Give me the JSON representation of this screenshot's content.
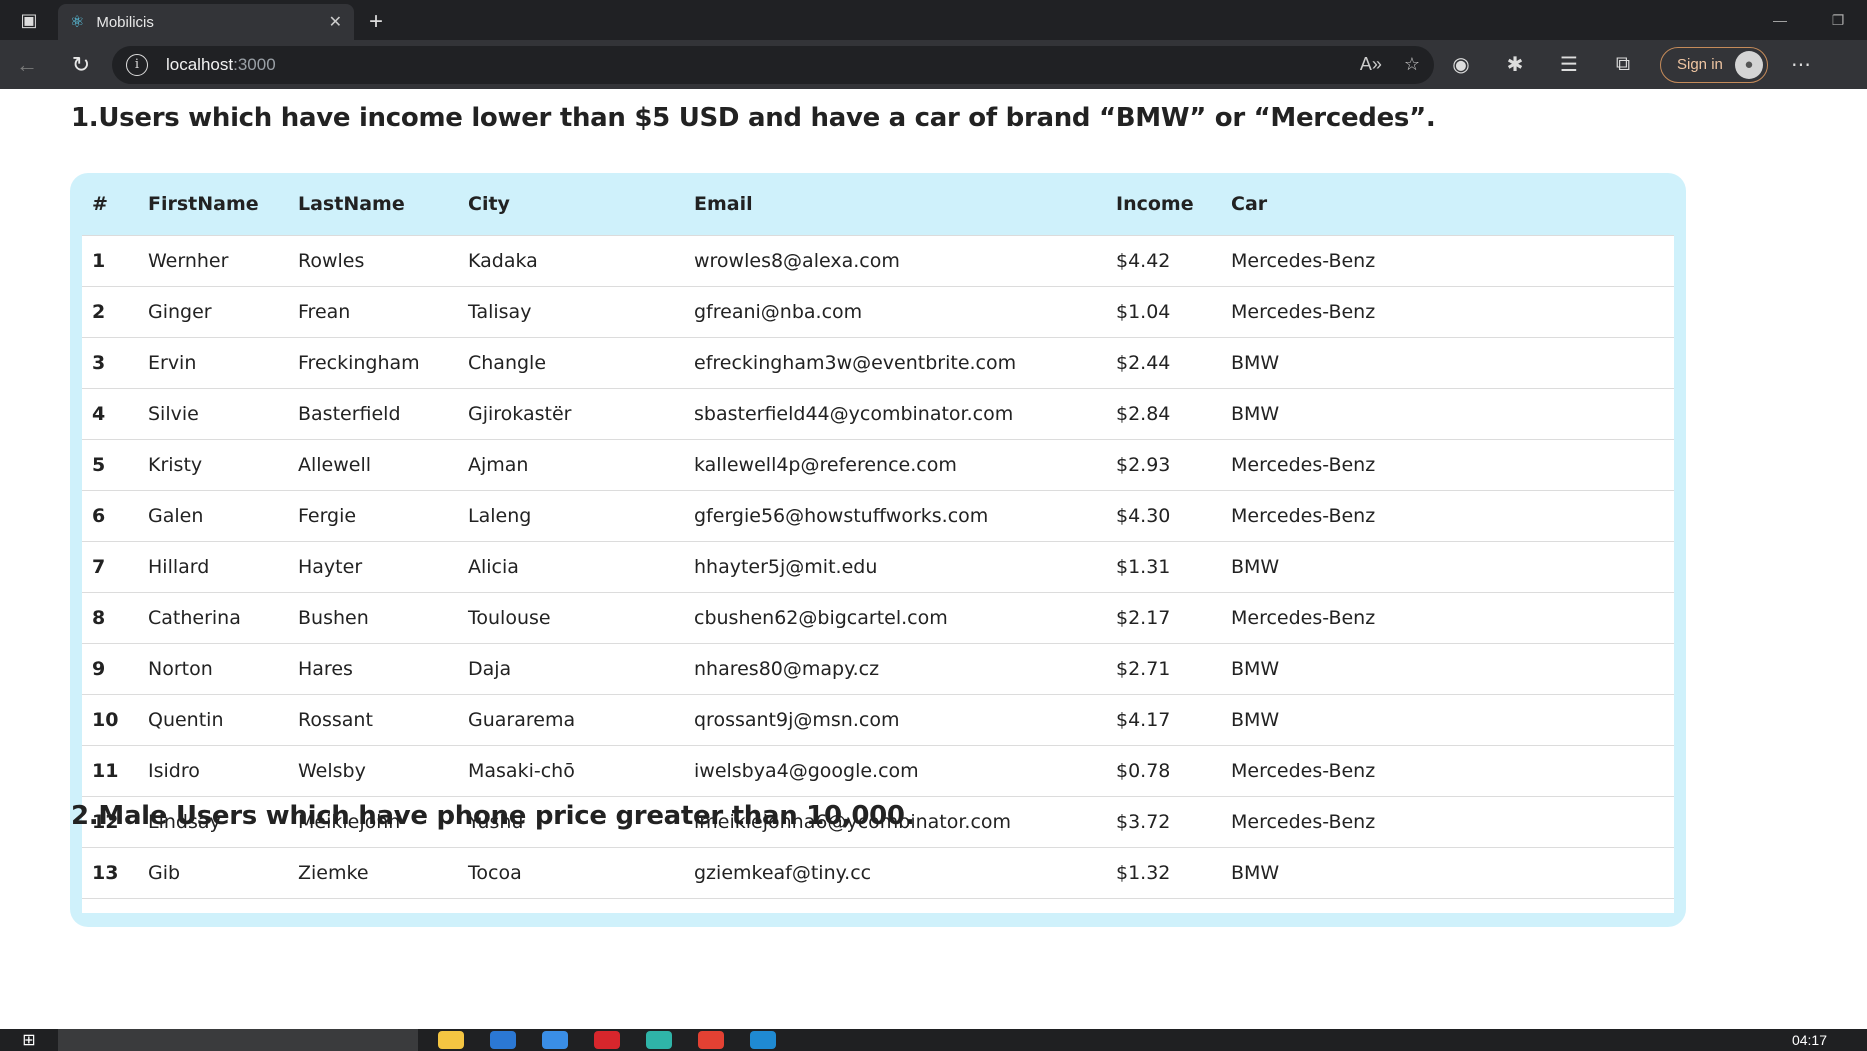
{
  "browser": {
    "tab_title": "Mobilicis",
    "url_host": "localhost",
    "url_port": ":3000",
    "signin_label": "Sign in"
  },
  "page": {
    "heading1": "1.Users which have income lower than $5 USD and have a car of brand “BMW” or “Mercedes”.",
    "heading2": "2.Male Users which have phone price greater than 10,000.",
    "table": {
      "columns": [
        "#",
        "FirstName",
        "LastName",
        "City",
        "Email",
        "Income",
        "Car"
      ],
      "rows": [
        [
          "1",
          "Wernher",
          "Rowles",
          "Kadaka",
          "wrowles8@alexa.com",
          "$4.42",
          "Mercedes-Benz"
        ],
        [
          "2",
          "Ginger",
          "Frean",
          "Talisay",
          "gfreani@nba.com",
          "$1.04",
          "Mercedes-Benz"
        ],
        [
          "3",
          "Ervin",
          "Freckingham",
          "Changle",
          "efreckingham3w@eventbrite.com",
          "$2.44",
          "BMW"
        ],
        [
          "4",
          "Silvie",
          "Basterfield",
          "Gjirokastër",
          "sbasterfield44@ycombinator.com",
          "$2.84",
          "BMW"
        ],
        [
          "5",
          "Kristy",
          "Allewell",
          "Ajman",
          "kallewell4p@reference.com",
          "$2.93",
          "Mercedes-Benz"
        ],
        [
          "6",
          "Galen",
          "Fergie",
          "Laleng",
          "gfergie56@howstuffworks.com",
          "$4.30",
          "Mercedes-Benz"
        ],
        [
          "7",
          "Hillard",
          "Hayter",
          "Alicia",
          "hhayter5j@mit.edu",
          "$1.31",
          "BMW"
        ],
        [
          "8",
          "Catherina",
          "Bushen",
          "Toulouse",
          "cbushen62@bigcartel.com",
          "$2.17",
          "Mercedes-Benz"
        ],
        [
          "9",
          "Norton",
          "Hares",
          "Daja",
          "nhares80@mapy.cz",
          "$2.71",
          "BMW"
        ],
        [
          "10",
          "Quentin",
          "Rossant",
          "Guararema",
          "qrossant9j@msn.com",
          "$4.17",
          "BMW"
        ],
        [
          "11",
          "Isidro",
          "Welsby",
          "Masaki-chō",
          "iwelsbya4@google.com",
          "$0.78",
          "Mercedes-Benz"
        ],
        [
          "12",
          "Lindsay",
          "Meiklejohn",
          "Yushu",
          "lmeiklejohna6@ycombinator.com",
          "$3.72",
          "Mercedes-Benz"
        ],
        [
          "13",
          "Gib",
          "Ziemke",
          "Tocoa",
          "gziemkeaf@tiny.cc",
          "$1.32",
          "BMW"
        ]
      ]
    }
  },
  "taskbar": {
    "clock": "04:17"
  },
  "colors": {
    "card_bg": "#cff1fb",
    "chrome_dark": "#202124",
    "chrome_toolbar": "#333438"
  }
}
